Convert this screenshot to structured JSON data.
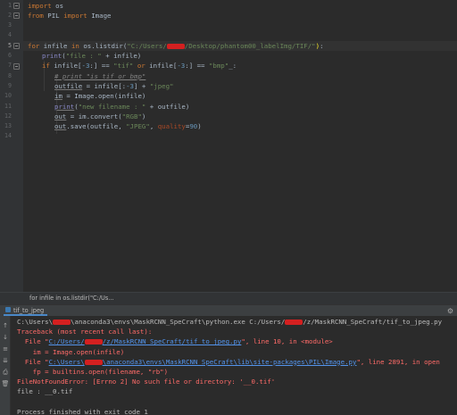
{
  "editor": {
    "line_numbers": [
      "1",
      "2",
      "3",
      "4",
      "5",
      "6",
      "7",
      "8",
      "9",
      "10",
      "11",
      "12",
      "13",
      "14"
    ],
    "current_line": "5",
    "code": {
      "l1_kw": "import",
      "l1_mod": " os",
      "l2_kw1": "from",
      "l2_mod": " PIL ",
      "l2_kw2": "import",
      "l2_name": " Image",
      "l5_kw1": "for",
      "l5_var": " infile ",
      "l5_kw2": "in",
      "l5_call": " os.listdir(",
      "l5_str_a": "\"C:/Users/",
      "l5_str_b": "/Desktop/phantom00_labelImg/TIF/\"",
      "l5_close": ")",
      "l5_colon": ":",
      "l6_fn": "print",
      "l6_open": "(",
      "l6_str": "\"file : \"",
      "l6_rest": " + infile)",
      "l7_kw": "if",
      "l7_a": " infile[",
      "l7_n1": "-3",
      "l7_b": ":] == ",
      "l7_s1": "\"tif\"",
      "l7_c": " ",
      "l7_kw2": "or",
      "l7_d": " infile[",
      "l7_n2": "-3",
      "l7_e": ":] == ",
      "l7_s2": "\"bmp\"",
      "l7_f": "_:",
      "l8_comment": "# print \"is tif or bmp\"",
      "l9_a": "outfile",
      "l9_b": " = infile[:",
      "l9_n": "-3",
      "l9_c": "] + ",
      "l9_s": "\"jpeg\"",
      "l10_a": "im",
      "l10_b": " = Image.open(infile)",
      "l11_fn": "print",
      "l11_a": "(",
      "l11_s": "\"new filename : \"",
      "l11_b": " + outfile)",
      "l12_a": "out",
      "l12_b": " = im.convert(",
      "l12_s": "\"RGB\"",
      "l12_c": ")",
      "l13_a": "out",
      "l13_b": ".save(outfile, ",
      "l13_s": "\"JPEG\"",
      "l13_c": ", ",
      "l13_p": "quality",
      "l13_d": "=",
      "l13_n": "90",
      "l13_e": ")"
    }
  },
  "breadcrumb": "for infile in os.listdir(\"C:/Us...",
  "run_panel": {
    "tab_label": "tif_to_jpeg",
    "settings_icon": "gear-icon",
    "toolbar_icons": [
      "arrow-up-icon",
      "arrow-down-icon",
      "soft-wrap-icon",
      "scroll-to-end-icon",
      "print-icon",
      "trash-icon"
    ],
    "console": {
      "cmd_a": "C:\\Users\\",
      "cmd_b": "\\anaconda3\\envs\\MaskRCNN_SpeCraft\\python.exe C:/Users/",
      "cmd_c": "/z/MaskRCNN_SpeCraft/tif_to_jpeg.py",
      "traceback": "Traceback (most recent call last):",
      "f1_pre": "  File \"",
      "f1_link_a": "C:/Users/",
      "f1_link_b": "/z/MaskRCNN_SpeCraft/tif_to_jpeg.py",
      "f1_post": "\", line 10, in <module>",
      "f1_code": "    im = Image.open(infile)",
      "f2_pre": "  File \"",
      "f2_link_a": "C:\\Users\\",
      "f2_link_b": "\\anaconda3\\envs\\MaskRCNN_SpeCraft\\lib\\site-packages\\PIL\\Image.py",
      "f2_post": "\", line 2891, in open",
      "f2_code": "    fp = builtins.open(filename, \"rb\")",
      "error": "FileNotFoundError: [Errno 2] No such file or directory: '__0.tif'",
      "file_out": "file : __0.tif",
      "finished": "Process finished with exit code 1"
    }
  },
  "colors": {
    "editor_bg": "#2b2b2b",
    "keyword": "#cc7832",
    "string": "#6a8759",
    "number": "#6897bb",
    "error": "#ff6b68",
    "link": "#5394ec",
    "redaction": "#d42020"
  }
}
